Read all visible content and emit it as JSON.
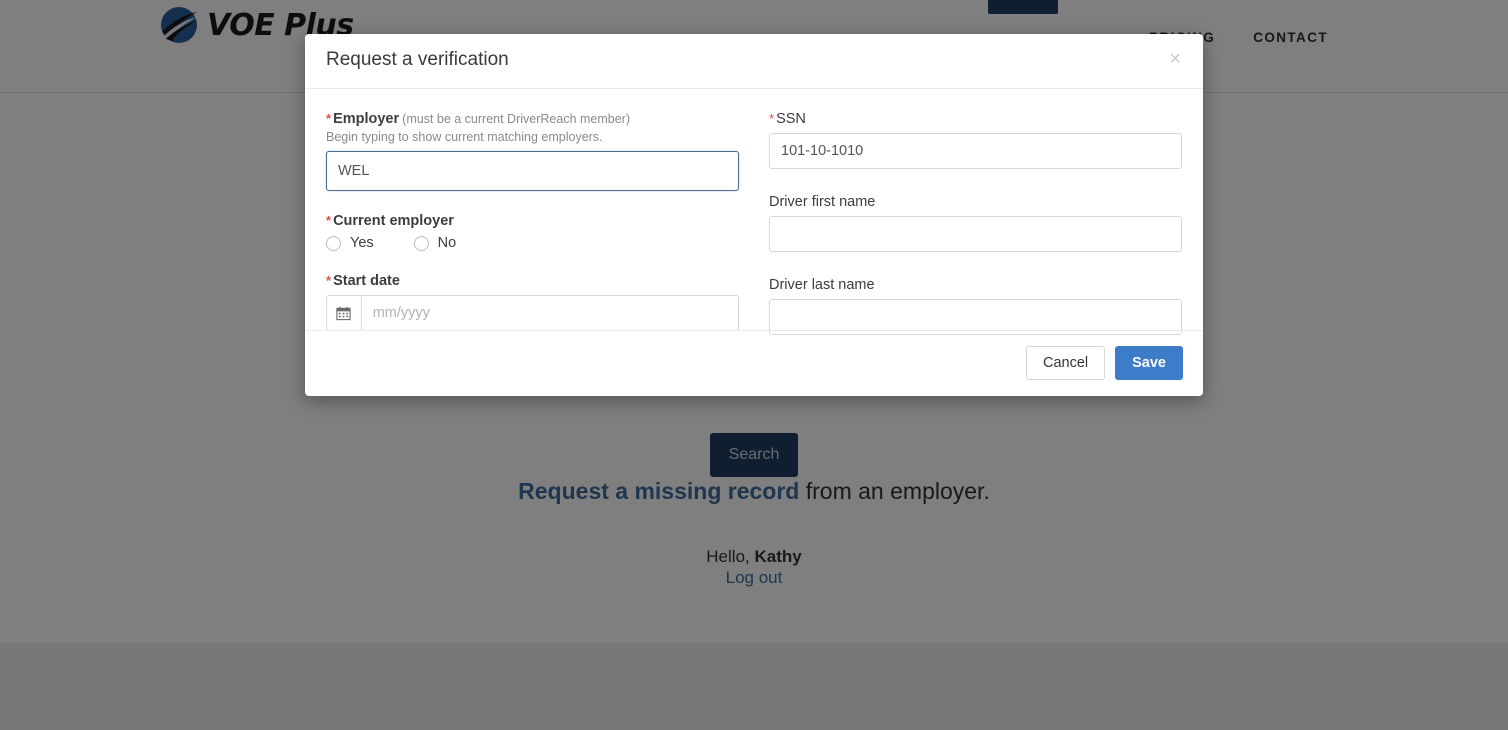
{
  "site": {
    "brand_name": "VOE Plus",
    "nav": [
      "PRICING",
      "CONTACT"
    ],
    "search_button": "Search",
    "missing_record_link": "Request a missing record",
    "missing_record_rest": " from an employer.",
    "greeting_prefix": "Hello, ",
    "greeting_name": "Kathy",
    "logout": "Log out"
  },
  "modal": {
    "title": "Request a verification",
    "close_icon": "×",
    "left_column": {
      "employer": {
        "label": "Employer",
        "label_hint": "(must be a current DriverReach member)",
        "sublabel": "Begin typing to show current matching employers.",
        "value": "WEL",
        "placeholder": ""
      },
      "current_employer": {
        "label": "Current employer",
        "options": [
          "Yes",
          "No"
        ],
        "selected": ""
      },
      "start_date": {
        "label": "Start date",
        "placeholder": "mm/yyyy",
        "value": "",
        "icon": "calendar-icon"
      }
    },
    "right_column": {
      "ssn": {
        "label": "SSN",
        "value": "101-10-1010",
        "placeholder": ""
      },
      "driver_first_name": {
        "label": "Driver first name",
        "value": "",
        "placeholder": ""
      },
      "driver_last_name": {
        "label": "Driver last name",
        "value": "",
        "placeholder": ""
      }
    },
    "footer": {
      "cancel": "Cancel",
      "save": "Save"
    }
  },
  "colors": {
    "primary_blue": "#3d7cc9",
    "navy": "#1f3d63",
    "link_blue": "#3d6d9e",
    "required_red": "#d9534f",
    "focus_border": "#4a6f91"
  }
}
